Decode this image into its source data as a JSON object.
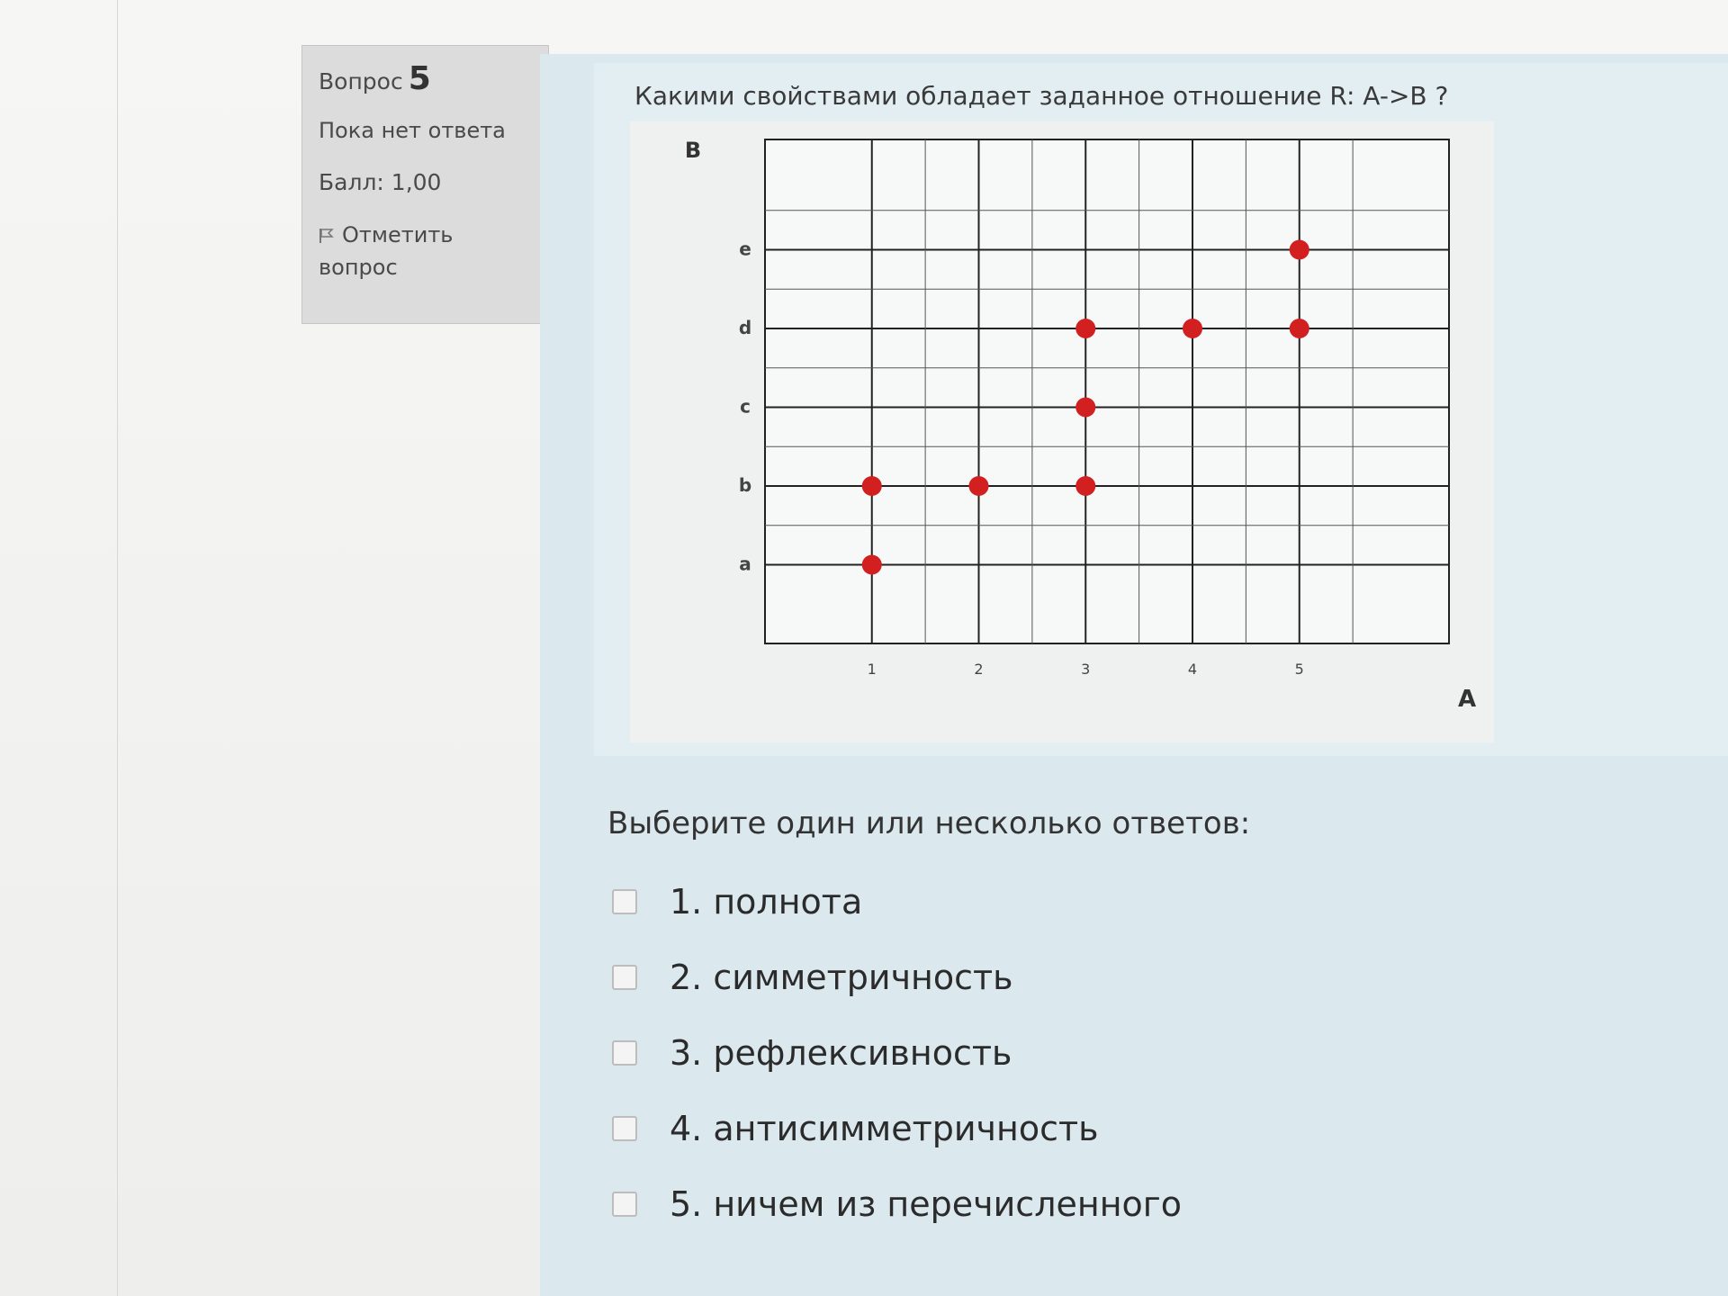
{
  "info": {
    "question_label": "Вопрос",
    "question_number": "5",
    "state": "Пока нет ответа",
    "grade": "Балл: 1,00",
    "flag_label": "Отметить вопрос"
  },
  "question": {
    "text": "Какими свойствами обладает заданное отношение R: A->B ?"
  },
  "chart_data": {
    "type": "scatter",
    "xlabel": "A",
    "ylabel": "B",
    "x_ticks": [
      "1",
      "2",
      "3",
      "4",
      "5"
    ],
    "y_ticks": [
      "a",
      "b",
      "c",
      "d",
      "e"
    ],
    "grid": true,
    "points": [
      {
        "x": "1",
        "y": "a"
      },
      {
        "x": "1",
        "y": "b"
      },
      {
        "x": "2",
        "y": "b"
      },
      {
        "x": "3",
        "y": "b"
      },
      {
        "x": "3",
        "y": "c"
      },
      {
        "x": "3",
        "y": "d"
      },
      {
        "x": "4",
        "y": "d"
      },
      {
        "x": "5",
        "y": "d"
      },
      {
        "x": "5",
        "y": "e"
      }
    ],
    "point_color": "#d21f1f"
  },
  "answers": {
    "prompt": "Выберите один или несколько ответов:",
    "options": [
      {
        "label": "1. полнота",
        "checked": false
      },
      {
        "label": "2. симметричность",
        "checked": false
      },
      {
        "label": "3. рефлексивность",
        "checked": false
      },
      {
        "label": "4. антисимметричность",
        "checked": false
      },
      {
        "label": "5. ничем из перечисленного",
        "checked": false
      }
    ]
  }
}
